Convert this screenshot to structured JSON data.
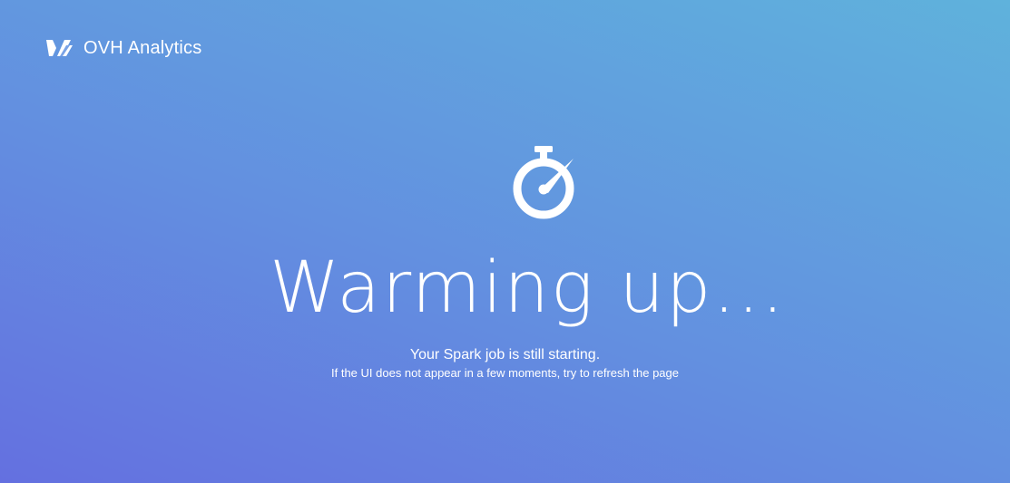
{
  "brand": {
    "logo_icon": "ovh-logo-icon",
    "name": "OVH Analytics"
  },
  "status": {
    "icon": "stopwatch-icon",
    "headline": "Warming up...",
    "message": "Your Spark job is still starting.",
    "hint": "If the UI does not appear in a few moments, try to refresh the page"
  },
  "colors": {
    "gradient_start": "#6470e0",
    "gradient_mid": "#6390e0",
    "gradient_end": "#5fb2dc",
    "text": "#ffffff"
  }
}
